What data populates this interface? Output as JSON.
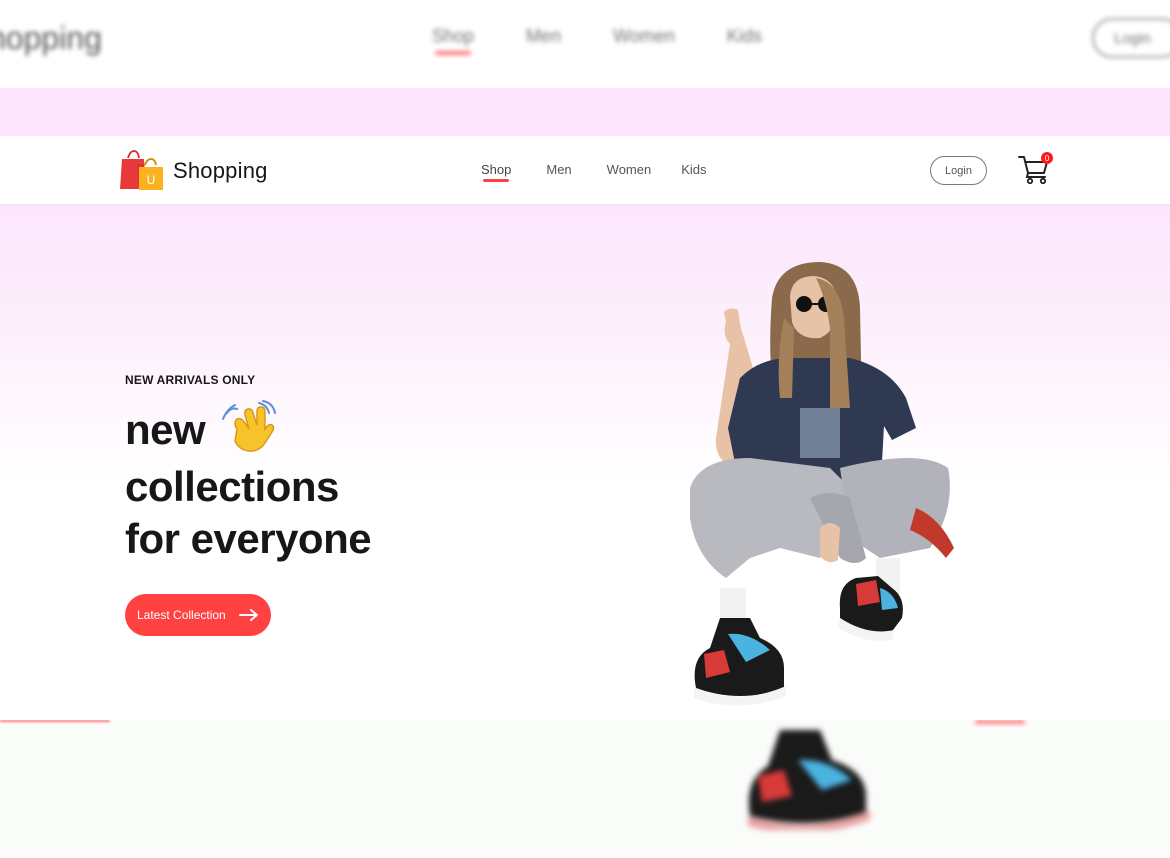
{
  "background": {
    "brand": "hopping",
    "menu": [
      "Shop",
      "Men",
      "Women",
      "Kids"
    ],
    "login": "Login"
  },
  "navbar": {
    "brand": "Shopping",
    "logo_letter": "U",
    "menu": [
      {
        "label": "Shop",
        "active": true
      },
      {
        "label": "Men"
      },
      {
        "label": "Women"
      },
      {
        "label": "Kids"
      }
    ],
    "login": "Login",
    "cart_count": "0",
    "icons": [
      "shopping-bag-logo-icon",
      "cart-icon"
    ]
  },
  "hero": {
    "kicker": "NEW ARRIVALS ONLY",
    "line1": "new",
    "line2": "collections",
    "line3": "for everyone",
    "cta": "Latest Collection",
    "icons": [
      "waving-hand-icon",
      "arrow-right-icon"
    ]
  },
  "colors": {
    "accent": "#ff4141",
    "pink": "#fbe0fb",
    "text": "#171717"
  }
}
